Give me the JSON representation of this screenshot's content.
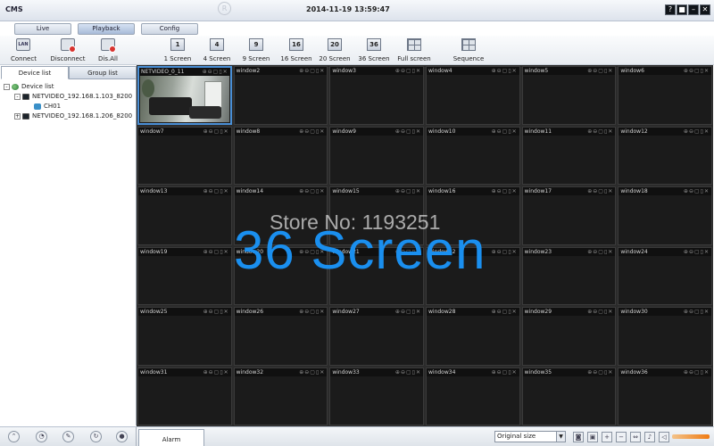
{
  "title_bar": {
    "app_title": "CMS",
    "clock": "2014-11-19 13:59:47",
    "registered_mark": "R",
    "window_buttons": [
      {
        "name": "help",
        "glyph": "?"
      },
      {
        "name": "lock",
        "glyph": "■"
      },
      {
        "name": "minimize",
        "glyph": "–"
      },
      {
        "name": "close",
        "glyph": "✕"
      }
    ]
  },
  "tabs": [
    {
      "label": "Live",
      "active": false
    },
    {
      "label": "Playback",
      "active": true
    },
    {
      "label": "Config",
      "active": false
    }
  ],
  "toolbar": {
    "connect": "Connect",
    "disconnect": "Disconnect",
    "dis_all": "Dis.All",
    "screen_1": {
      "label": "1 Screen",
      "icon_text": "1"
    },
    "screen_4": {
      "label": "4 Screen",
      "icon_text": "4"
    },
    "screen_9": {
      "label": "9 Screen",
      "icon_text": "9"
    },
    "screen_16": {
      "label": "16 Screen",
      "icon_text": "16"
    },
    "screen_20": {
      "label": "20 Screen",
      "icon_text": "20"
    },
    "screen_36": {
      "label": "36 Screen",
      "icon_text": "36"
    },
    "full_screen": "Full screen",
    "sequence": "Sequence"
  },
  "left_panel": {
    "tabs": [
      {
        "label": "Device list",
        "active": true
      },
      {
        "label": "Group list",
        "active": false
      }
    ],
    "tree": [
      {
        "label": "Device list",
        "level": 0,
        "expander": "-",
        "icon": "globe-icon"
      },
      {
        "label": "NETVIDEO_192.168.1.103_8200",
        "level": 1,
        "expander": "-",
        "icon": "dvr-icon"
      },
      {
        "label": "CH01",
        "level": 2,
        "expander": "",
        "icon": "camera-icon"
      },
      {
        "label": "NETVIDEO_192.168.1.206_8200",
        "level": 1,
        "expander": "+",
        "icon": "dvr-icon"
      }
    ]
  },
  "grid": {
    "columns": 6,
    "rows": 6,
    "control_glyphs": "⊕⊖▢▯✕",
    "windows": [
      "NETVIDEO_0_11",
      "window2",
      "window3",
      "window4",
      "window5",
      "window6",
      "window7",
      "window8",
      "window9",
      "window10",
      "window11",
      "window12",
      "window13",
      "window14",
      "window15",
      "window16",
      "window17",
      "window18",
      "window19",
      "window20",
      "window21",
      "window22",
      "window23",
      "window24",
      "window25",
      "window26",
      "window27",
      "window28",
      "window29",
      "window30",
      "window31",
      "window32",
      "window33",
      "window34",
      "window35",
      "window36"
    ],
    "active_window_index": 0
  },
  "watermarks": {
    "store": "Store No: 1193251",
    "screen": "36 Screen",
    "screen_color": "#1a8fef"
  },
  "bottom_bar": {
    "alarm_tab": "Alarm",
    "size_select_value": "Original size",
    "volume_fraction": 1.0
  },
  "colors": {
    "accent": "#4a8fd6",
    "grid_bg": "#1b1b1b",
    "volume": "#ef7a12"
  }
}
